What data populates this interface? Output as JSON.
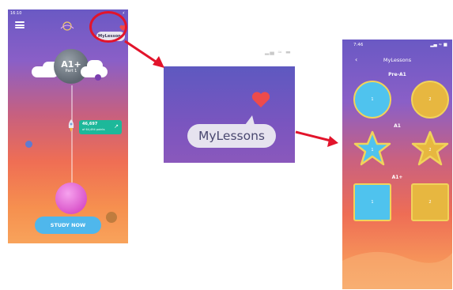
{
  "left_screen": {
    "status_time": "16:10",
    "status_right": "⚡",
    "mylessons_label": "MyLessons",
    "level_title": "A1+",
    "level_subtitle": "Part 1",
    "progress_value": "46,697",
    "progress_caption": "of 64,494 points",
    "study_button": "STUDY NOW"
  },
  "middle_zoom": {
    "status_icons": "▂▄ ≈ ▬",
    "mylessons_label": "MyLessons"
  },
  "right_screen": {
    "status_time": "7:46",
    "status_right": "▂▄ ≈ ■",
    "back_label": "‹",
    "title": "MyLessons",
    "sections": [
      {
        "label": "Pre-A1",
        "items": [
          "1",
          "2"
        ]
      },
      {
        "label": "A1",
        "items": [
          "1",
          "2"
        ]
      },
      {
        "label": "A1+",
        "items": [
          "1",
          "2"
        ]
      }
    ]
  },
  "colors": {
    "callout_red": "#e2142b",
    "heart": "#ee4b4b",
    "blue_item": "#4fc3ee",
    "yellow_item": "#e7b740",
    "study_button": "#4fb7ec"
  }
}
